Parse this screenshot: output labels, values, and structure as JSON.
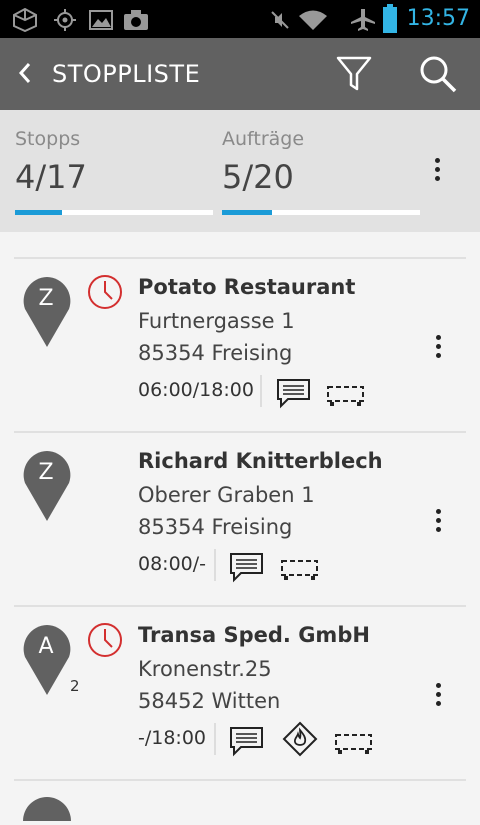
{
  "status_bar": {
    "time": "13:57"
  },
  "header": {
    "title": "STOPPLISTE"
  },
  "summary": {
    "stops_label": "Stopps",
    "stops_value": "4/17",
    "stops_progress": 0.235,
    "orders_label": "Aufträge",
    "orders_value": "5/20",
    "orders_progress": 0.25
  },
  "colors": {
    "accent": "#1b9bd7",
    "clock": "#d32f2f",
    "pin": "#616161"
  },
  "stops": [
    {
      "pin": "Z",
      "pin_count": "",
      "name": "Potato Restaurant",
      "street": "Furtnergasse 1",
      "city": "85354 Freising",
      "time": "06:00/18:00",
      "has_clock": true,
      "has_hazmat": false
    },
    {
      "pin": "Z",
      "pin_count": "",
      "name": "Richard Knitterblech",
      "street": "Oberer Graben 1",
      "city": "85354 Freising",
      "time": "08:00/-",
      "has_clock": false,
      "has_hazmat": false
    },
    {
      "pin": "A",
      "pin_count": "2",
      "name": "Transa Sped. GmbH",
      "street": "Kronenstr.25",
      "city": "58452 Witten",
      "time": "-/18:00",
      "has_clock": true,
      "has_hazmat": true
    }
  ]
}
